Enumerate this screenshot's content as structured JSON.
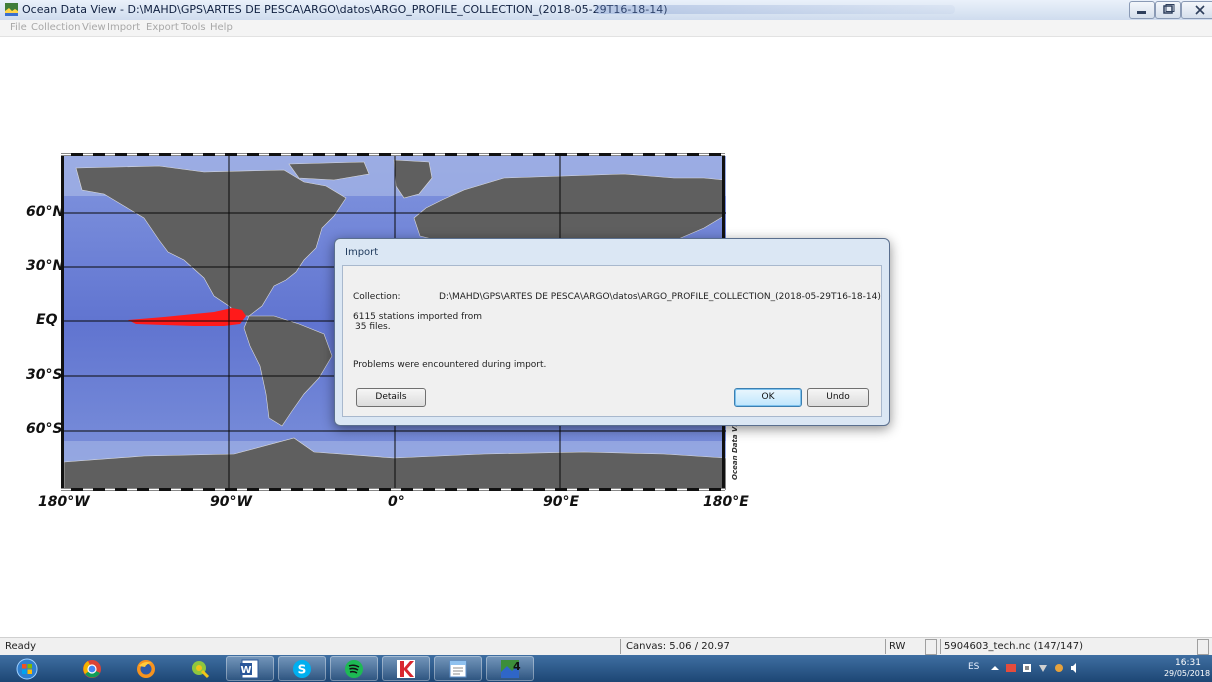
{
  "window": {
    "title": "Ocean Data View - D:\\MAHD\\GPS\\ARTES DE PESCA\\ARGO\\datos\\ARGO_PROFILE_COLLECTION_(2018-05-29T16-18-14)"
  },
  "menu": [
    "File",
    "Collection",
    "View",
    "Import",
    "Export",
    "Tools",
    "Help"
  ],
  "map": {
    "lat_labels": [
      "60°N",
      "30°N",
      "EQ",
      "30°S",
      "60°S"
    ],
    "lon_labels": [
      "180°W",
      "90°W",
      "0°",
      "90°E",
      "180°E"
    ],
    "watermark": "Ocean Data View",
    "colors": {
      "ocean": "#6f86d6",
      "deep_ocean": "#4e63c0",
      "land": "#5f5f5f",
      "stations": "#ff0000"
    }
  },
  "dialog": {
    "title": "Import",
    "collection_label": "Collection:",
    "collection_path": "D:\\MAHD\\GPS\\ARTES DE PESCA\\ARGO\\datos\\ARGO_PROFILE_COLLECTION_(2018-05-29T16-18-14)",
    "summary_line1": "6115 stations imported from",
    "summary_line2": "35 files.",
    "problems": "Problems were encountered during import.",
    "details_button": "Details",
    "ok_button": "OK",
    "undo_button": "Undo"
  },
  "status": {
    "ready": "Ready",
    "canvas": "Canvas: 5.06 / 20.97",
    "mode": "RW",
    "file": "5904603_tech.nc (147/147)"
  },
  "taskbar": {
    "apps": [
      "windows-start",
      "chrome",
      "firefox",
      "qgis",
      "word",
      "skype",
      "spotify",
      "kaspersky",
      "notepad",
      "ocean-data-view"
    ],
    "language": "ES",
    "time": "16:31",
    "date": "29/05/2018"
  }
}
